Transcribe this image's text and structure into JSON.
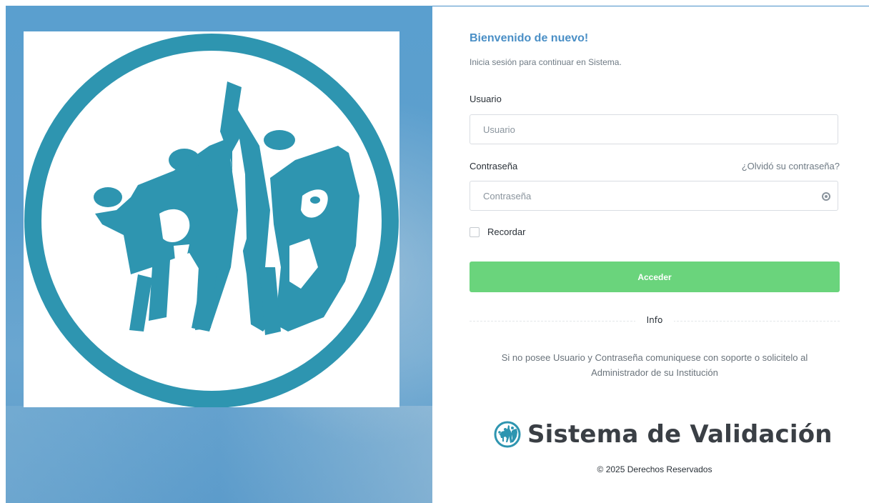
{
  "colors": {
    "accent": "#4a8fc6",
    "logo_teal": "#2e95b0",
    "submit_green": "#6ad47c",
    "hero_blue": "#5d9fcd"
  },
  "icons": {
    "hero_logo": "institution-logo",
    "password_toggle": "eye-icon",
    "brand_logo": "institution-logo-small"
  },
  "login": {
    "welcome": "Bienvenido de nuevo!",
    "subtitle": "Inicia sesión para continuar en Sistema.",
    "username_label": "Usuario",
    "username_placeholder": "Usuario",
    "password_label": "Contraseña",
    "password_placeholder": "Contraseña",
    "forgot_link": "¿Olvidó su contraseña?",
    "remember_label": "Recordar",
    "submit_label": "Acceder",
    "divider_label": "Info",
    "info_line1": "Si no posee Usuario y Contraseña comuniquese con soporte o solicitelo al",
    "info_line2": "Administrador de su Institución"
  },
  "brand": {
    "name": "Sistema de Validación",
    "copyright": "© 2025 Derechos Reservados"
  }
}
